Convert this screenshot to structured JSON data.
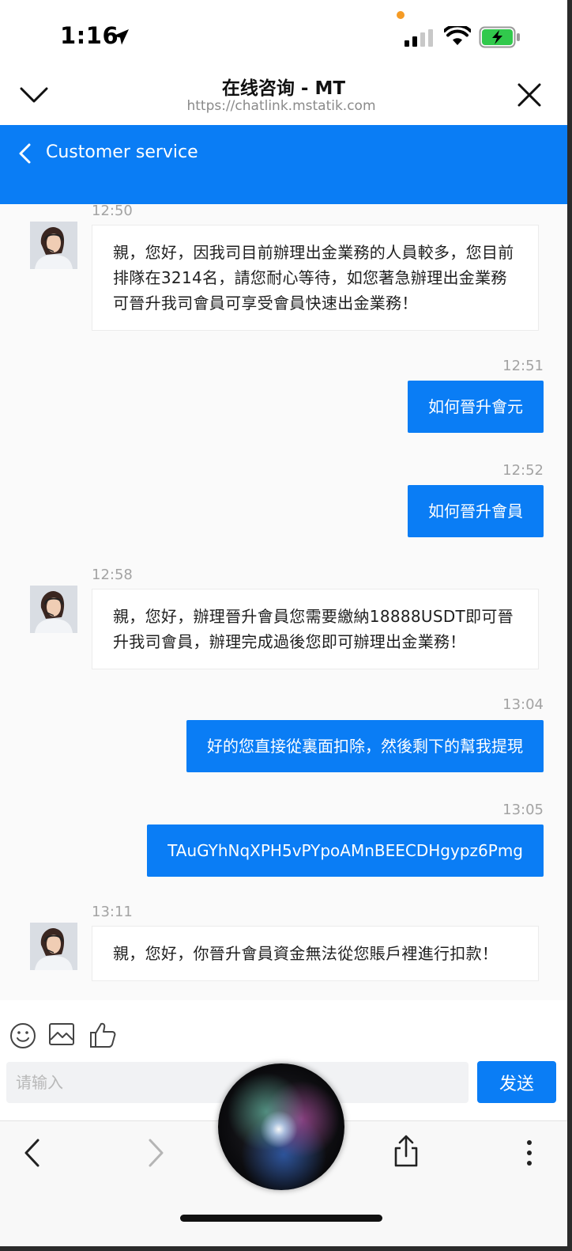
{
  "status_bar": {
    "time": "1:16"
  },
  "browser_header": {
    "title": "在线咨询 - MT",
    "url": "https://chatlink.mstatik.com"
  },
  "app_header": {
    "title": "Customer service"
  },
  "messages": [
    {
      "side": "in",
      "time": "12:50",
      "text": "親，您好，因我司目前辦理出金業務的人員較多，您目前排隊在3214名，請您耐心等待，如您著急辦理出金業務可晉升我司會員可享受會員快速出金業務！"
    },
    {
      "side": "out",
      "time": "12:51",
      "text": "如何晉升會元"
    },
    {
      "side": "out",
      "time": "12:52",
      "text": "如何晉升會員"
    },
    {
      "side": "in",
      "time": "12:58",
      "text": "親，您好，辦理晉升會員您需要繳納18888USDT即可晉升我司會員，辦理完成過後您即可辦理出金業務！"
    },
    {
      "side": "out",
      "time": "13:04",
      "text": "好的您直接從裏面扣除，然後剩下的幫我提現"
    },
    {
      "side": "out",
      "time": "13:05",
      "text": "TAuGYhNqXPH5vPYpoAMnBEECDHgypz6Pmg"
    },
    {
      "side": "in",
      "time": "13:11",
      "text": "親，您好，你晉升會員資金無法從您賬戶裡進行扣款！"
    }
  ],
  "composer": {
    "placeholder": "请输入",
    "send_label": "发送"
  },
  "colors": {
    "accent": "#0a7df5",
    "background": "#fafafa",
    "timestamp": "#a3a3a3"
  }
}
